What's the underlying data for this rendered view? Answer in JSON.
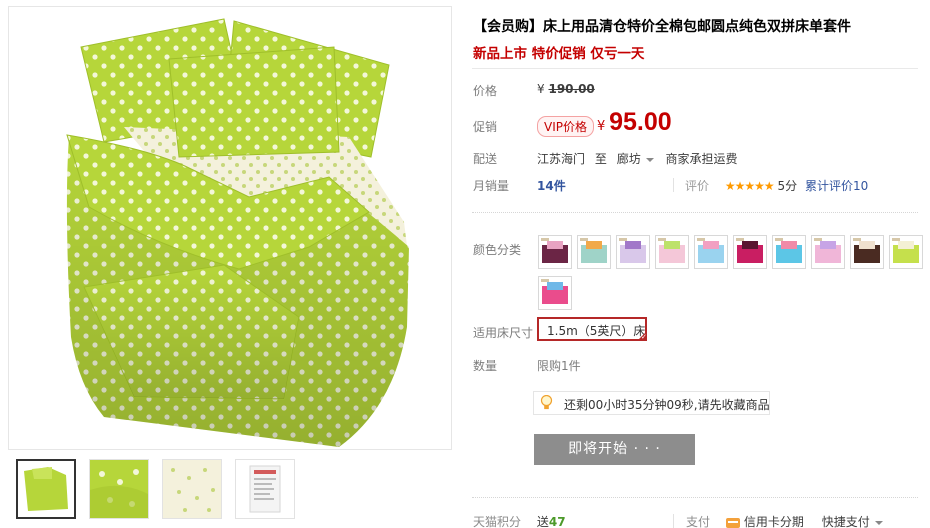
{
  "product": {
    "title": "【会员购】床上用品清仓特价全棉包邮圆点纯色双拼床单套件",
    "subtitle": "新品上市 特价促销 仅亏一天"
  },
  "price": {
    "label": "价格",
    "currency": "¥",
    "original": "190.00"
  },
  "promo": {
    "label": "促销",
    "vip_tag": "VIP价格",
    "currency": "¥",
    "price": "95.00"
  },
  "shipping": {
    "label": "配送",
    "from": "江苏海门",
    "to_word": "至",
    "destination": "廊坊",
    "fee_note": "商家承担运费"
  },
  "sales": {
    "label": "月销量",
    "count": "14",
    "unit": "件"
  },
  "rating": {
    "label": "评价",
    "stars": "★★★★★",
    "score": "5分",
    "reviews_text": "累计评价10"
  },
  "options": {
    "color_label": "颜色分类",
    "color_swatches": [
      {
        "name": "swatch-1",
        "main": "#6b2545",
        "accent": "#e8a3c2"
      },
      {
        "name": "swatch-2",
        "main": "#9fd3c8",
        "accent": "#f1a94a"
      },
      {
        "name": "swatch-3",
        "main": "#d9c8ea",
        "accent": "#a178c9"
      },
      {
        "name": "swatch-4",
        "main": "#f4c7d8",
        "accent": "#bde26a"
      },
      {
        "name": "swatch-5",
        "main": "#9ad3ef",
        "accent": "#f2a0c2"
      },
      {
        "name": "swatch-6",
        "main": "#c91e62",
        "accent": "#5a1630"
      },
      {
        "name": "swatch-7",
        "main": "#5cc6e6",
        "accent": "#f08aa8"
      },
      {
        "name": "swatch-8",
        "main": "#f0b6d8",
        "accent": "#c7a4e6"
      },
      {
        "name": "swatch-9",
        "main": "#4a2b22",
        "accent": "#f0e1cf"
      },
      {
        "name": "swatch-10",
        "main": "#c5e04c",
        "accent": "#f4f0d4"
      },
      {
        "name": "swatch-11",
        "main": "#ea4c8c",
        "accent": "#6fb8e8"
      }
    ],
    "size_label": "适用床尺寸",
    "size_selected": "1.5m（5英尺）床",
    "quantity_label": "数量",
    "quantity_limit": "限购1件"
  },
  "notice": {
    "text": "还剩00小时35分钟09秒,请先收藏商品"
  },
  "action": {
    "button_label": "即将开始 · · ·"
  },
  "footer": {
    "points_label": "天猫积分",
    "points_prefix": "送",
    "points_value": "47",
    "pay_label": "支付",
    "credit_card": "信用卡分期",
    "quick_pay": "快捷支付"
  },
  "colors": {
    "price_red": "#c40000",
    "bedding_green": "#b6d63a",
    "button_gray": "#8d8d8d",
    "link_blue": "#33559f"
  }
}
